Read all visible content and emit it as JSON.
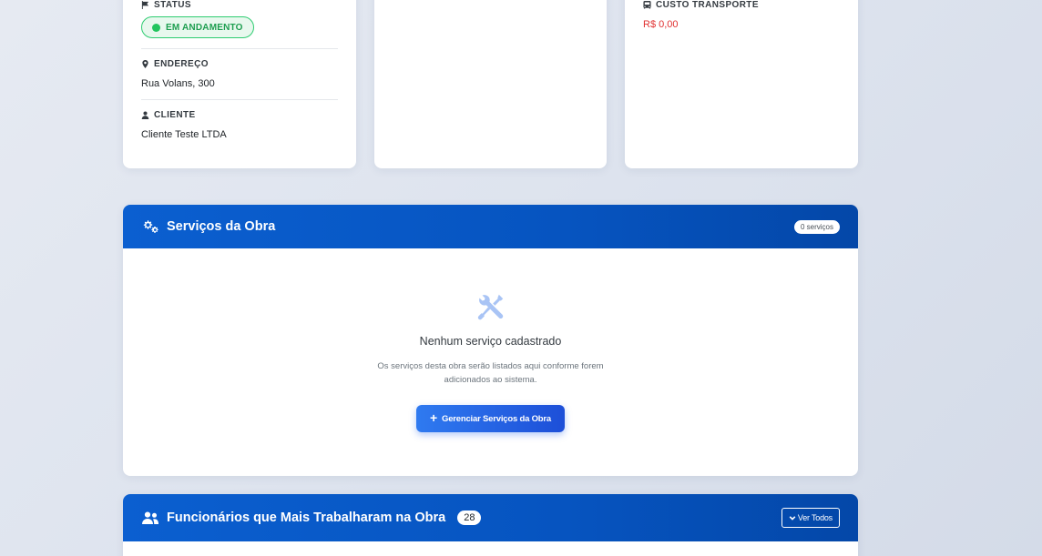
{
  "info_cards": {
    "left": {
      "status": {
        "label": "STATUS",
        "value": "EM ANDAMENTO",
        "color": "#22c55e"
      },
      "address": {
        "label": "ENDEREÇO",
        "value": "Rua Volans, 300"
      },
      "client": {
        "label": "CLIENTE",
        "value": "Cliente Teste LTDA"
      }
    },
    "right": {
      "transport_cost": {
        "label": "CUSTO TRANSPORTE",
        "value": "R$ 0,00",
        "color": "#e03131"
      }
    }
  },
  "services": {
    "title": "Serviços da Obra",
    "count_badge": "0 serviços",
    "empty_title": "Nenhum serviço cadastrado",
    "empty_description": "Os serviços desta obra serão listados aqui conforme forem adicionados ao sistema.",
    "manage_button": "Gerenciar Serviços da Obra",
    "icons": {
      "header": "gears-icon",
      "empty": "tools-icon"
    }
  },
  "employees": {
    "title": "Funcionários que Mais Trabalharam na Obra",
    "count": "28",
    "view_all_button": "Ver Todos",
    "icons": {
      "header": "users-icon"
    }
  },
  "colors": {
    "header_blue": "#0654c0",
    "button_blue": "#2563eb"
  }
}
